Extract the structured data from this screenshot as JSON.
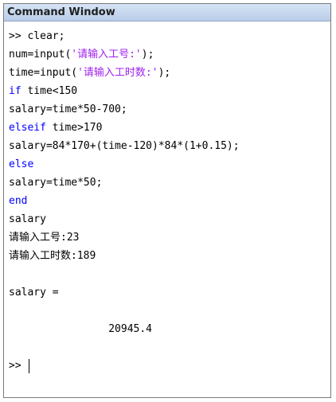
{
  "window": {
    "title": "Command Window"
  },
  "lines": [
    {
      "prompt": ">> ",
      "text": "clear;"
    },
    {
      "pre": "num=input(",
      "str": "'请输入工号:'",
      "post": ");"
    },
    {
      "pre": "time=input(",
      "str": "'请输入工时数:'",
      "post": ");"
    },
    {
      "kw": "if",
      "rest": " time<150"
    },
    {
      "text": "salary=time*50-700;"
    },
    {
      "kw": "elseif",
      "rest": " time>170"
    },
    {
      "text": "salary=84*170+(time-120)*84*(1+0.15);"
    },
    {
      "kw": "else"
    },
    {
      "text": "salary=time*50;"
    },
    {
      "kw": "end"
    },
    {
      "text": "salary"
    },
    {
      "text": "请输入工号:23"
    },
    {
      "text": "请输入工时数:189"
    },
    {
      "text": ""
    },
    {
      "text": "salary ="
    },
    {
      "text": ""
    },
    {
      "result": "                20945.4"
    },
    {
      "text": ""
    },
    {
      "prompt": ">> "
    }
  ],
  "colors": {
    "keyword": "#0000ff",
    "string": "#a020f0",
    "text": "#000000",
    "titlebar": "#c7d8ee"
  }
}
